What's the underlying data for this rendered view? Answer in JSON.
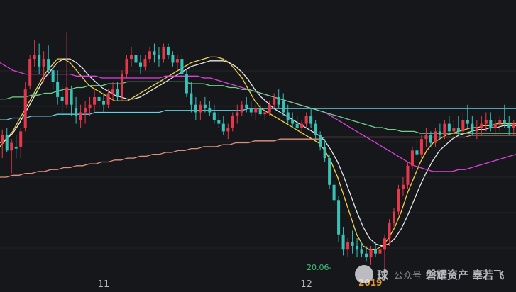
{
  "chart_data": {
    "type": "candlestick",
    "x_tick_labels": [
      {
        "label": "11",
        "bar": 22
      },
      {
        "label": "12",
        "bar": 66
      }
    ],
    "y_range": [
      0,
      100
    ],
    "date_readout": "20.06-",
    "year_badge": "2019",
    "candles": [
      {
        "o": 40,
        "h": 47,
        "l": 32,
        "c": 44
      },
      {
        "o": 44,
        "h": 48,
        "l": 35,
        "c": 36
      },
      {
        "o": 36,
        "h": 42,
        "l": 24,
        "c": 40
      },
      {
        "o": 38,
        "h": 44,
        "l": 32,
        "c": 37
      },
      {
        "o": 38,
        "h": 48,
        "l": 32,
        "c": 46
      },
      {
        "o": 48,
        "h": 72,
        "l": 46,
        "c": 68
      },
      {
        "o": 70,
        "h": 86,
        "l": 68,
        "c": 84
      },
      {
        "o": 84,
        "h": 94,
        "l": 80,
        "c": 86
      },
      {
        "o": 86,
        "h": 92,
        "l": 76,
        "c": 80
      },
      {
        "o": 80,
        "h": 88,
        "l": 72,
        "c": 84
      },
      {
        "o": 84,
        "h": 91,
        "l": 76,
        "c": 78
      },
      {
        "o": 78,
        "h": 82,
        "l": 68,
        "c": 72
      },
      {
        "o": 72,
        "h": 78,
        "l": 60,
        "c": 64
      },
      {
        "o": 64,
        "h": 70,
        "l": 54,
        "c": 62
      },
      {
        "o": 60,
        "h": 98,
        "l": 58,
        "c": 69
      },
      {
        "o": 68,
        "h": 70,
        "l": 54,
        "c": 60
      },
      {
        "o": 58,
        "h": 64,
        "l": 50,
        "c": 54
      },
      {
        "o": 52,
        "h": 60,
        "l": 48,
        "c": 56
      },
      {
        "o": 56,
        "h": 62,
        "l": 50,
        "c": 58
      },
      {
        "o": 58,
        "h": 64,
        "l": 54,
        "c": 60
      },
      {
        "o": 60,
        "h": 68,
        "l": 56,
        "c": 64
      },
      {
        "o": 64,
        "h": 70,
        "l": 58,
        "c": 62
      },
      {
        "o": 62,
        "h": 66,
        "l": 56,
        "c": 60
      },
      {
        "o": 60,
        "h": 68,
        "l": 58,
        "c": 66
      },
      {
        "o": 66,
        "h": 72,
        "l": 62,
        "c": 68
      },
      {
        "o": 68,
        "h": 72,
        "l": 62,
        "c": 64
      },
      {
        "o": 64,
        "h": 78,
        "l": 62,
        "c": 76
      },
      {
        "o": 76,
        "h": 86,
        "l": 74,
        "c": 84
      },
      {
        "o": 84,
        "h": 90,
        "l": 80,
        "c": 86
      },
      {
        "o": 86,
        "h": 88,
        "l": 78,
        "c": 82
      },
      {
        "o": 82,
        "h": 86,
        "l": 76,
        "c": 80
      },
      {
        "o": 80,
        "h": 86,
        "l": 78,
        "c": 84
      },
      {
        "o": 84,
        "h": 90,
        "l": 82,
        "c": 88
      },
      {
        "o": 88,
        "h": 92,
        "l": 82,
        "c": 86
      },
      {
        "o": 86,
        "h": 90,
        "l": 80,
        "c": 84
      },
      {
        "o": 84,
        "h": 92,
        "l": 82,
        "c": 90
      },
      {
        "o": 90,
        "h": 92,
        "l": 84,
        "c": 86
      },
      {
        "o": 86,
        "h": 88,
        "l": 80,
        "c": 82
      },
      {
        "o": 82,
        "h": 86,
        "l": 78,
        "c": 84
      },
      {
        "o": 84,
        "h": 86,
        "l": 74,
        "c": 76
      },
      {
        "o": 76,
        "h": 78,
        "l": 64,
        "c": 66
      },
      {
        "o": 66,
        "h": 72,
        "l": 56,
        "c": 60
      },
      {
        "o": 60,
        "h": 64,
        "l": 52,
        "c": 56
      },
      {
        "o": 56,
        "h": 62,
        "l": 52,
        "c": 60
      },
      {
        "o": 60,
        "h": 64,
        "l": 56,
        "c": 58
      },
      {
        "o": 58,
        "h": 62,
        "l": 54,
        "c": 56
      },
      {
        "o": 56,
        "h": 60,
        "l": 50,
        "c": 52
      },
      {
        "o": 52,
        "h": 56,
        "l": 48,
        "c": 50
      },
      {
        "o": 50,
        "h": 54,
        "l": 44,
        "c": 46
      },
      {
        "o": 46,
        "h": 50,
        "l": 42,
        "c": 48
      },
      {
        "o": 48,
        "h": 56,
        "l": 46,
        "c": 54
      },
      {
        "o": 54,
        "h": 60,
        "l": 50,
        "c": 56
      },
      {
        "o": 56,
        "h": 62,
        "l": 54,
        "c": 60
      },
      {
        "o": 60,
        "h": 64,
        "l": 56,
        "c": 58
      },
      {
        "o": 58,
        "h": 62,
        "l": 54,
        "c": 56
      },
      {
        "o": 56,
        "h": 60,
        "l": 52,
        "c": 58
      },
      {
        "o": 58,
        "h": 60,
        "l": 54,
        "c": 55
      },
      {
        "o": 55,
        "h": 58,
        "l": 52,
        "c": 56
      },
      {
        "o": 56,
        "h": 62,
        "l": 54,
        "c": 60
      },
      {
        "o": 60,
        "h": 66,
        "l": 58,
        "c": 64
      },
      {
        "o": 64,
        "h": 68,
        "l": 58,
        "c": 60
      },
      {
        "o": 62,
        "h": 66,
        "l": 54,
        "c": 56
      },
      {
        "o": 56,
        "h": 60,
        "l": 50,
        "c": 52
      },
      {
        "o": 52,
        "h": 56,
        "l": 48,
        "c": 50
      },
      {
        "o": 50,
        "h": 54,
        "l": 46,
        "c": 48
      },
      {
        "o": 48,
        "h": 52,
        "l": 44,
        "c": 50
      },
      {
        "o": 50,
        "h": 56,
        "l": 48,
        "c": 54
      },
      {
        "o": 54,
        "h": 58,
        "l": 48,
        "c": 50
      },
      {
        "o": 50,
        "h": 52,
        "l": 42,
        "c": 44
      },
      {
        "o": 44,
        "h": 46,
        "l": 36,
        "c": 38
      },
      {
        "o": 38,
        "h": 42,
        "l": 30,
        "c": 32
      },
      {
        "o": 32,
        "h": 34,
        "l": 16,
        "c": 18
      },
      {
        "o": 18,
        "h": 20,
        "l": 8,
        "c": 10
      },
      {
        "o": 10,
        "h": 12,
        "l": -12,
        "c": -8
      },
      {
        "o": -8,
        "h": -4,
        "l": -19,
        "c": -16
      },
      {
        "o": -16,
        "h": -10,
        "l": -20,
        "c": -12
      },
      {
        "o": -12,
        "h": -6,
        "l": -18,
        "c": -14
      },
      {
        "o": -14,
        "h": -10,
        "l": -20,
        "c": -16
      },
      {
        "o": -16,
        "h": -12,
        "l": -20,
        "c": -18
      },
      {
        "o": -18,
        "h": -14,
        "l": -22,
        "c": -20
      },
      {
        "o": -20,
        "h": -14,
        "l": -24,
        "c": -16
      },
      {
        "o": -16,
        "h": -12,
        "l": -20,
        "c": -18
      },
      {
        "o": -18,
        "h": -12,
        "l": -22,
        "c": -16
      },
      {
        "o": -16,
        "h": -8,
        "l": -26,
        "c": -10
      },
      {
        "o": -10,
        "h": 0,
        "l": -14,
        "c": -2
      },
      {
        "o": -2,
        "h": 6,
        "l": -4,
        "c": 4
      },
      {
        "o": 4,
        "h": 18,
        "l": 2,
        "c": 16
      },
      {
        "o": 16,
        "h": 22,
        "l": 12,
        "c": 18
      },
      {
        "o": 18,
        "h": 30,
        "l": 16,
        "c": 28
      },
      {
        "o": 28,
        "h": 38,
        "l": 26,
        "c": 36
      },
      {
        "o": 36,
        "h": 42,
        "l": 32,
        "c": 34
      },
      {
        "o": 34,
        "h": 44,
        "l": 32,
        "c": 42
      },
      {
        "o": 42,
        "h": 48,
        "l": 38,
        "c": 44
      },
      {
        "o": 44,
        "h": 46,
        "l": 38,
        "c": 40
      },
      {
        "o": 40,
        "h": 48,
        "l": 38,
        "c": 46
      },
      {
        "o": 46,
        "h": 50,
        "l": 42,
        "c": 44
      },
      {
        "o": 44,
        "h": 52,
        "l": 42,
        "c": 50
      },
      {
        "o": 50,
        "h": 54,
        "l": 44,
        "c": 46
      },
      {
        "o": 46,
        "h": 52,
        "l": 42,
        "c": 48
      },
      {
        "o": 48,
        "h": 54,
        "l": 44,
        "c": 46
      },
      {
        "o": 46,
        "h": 56,
        "l": 44,
        "c": 52
      },
      {
        "o": 52,
        "h": 60,
        "l": 48,
        "c": 50
      },
      {
        "o": 50,
        "h": 54,
        "l": 44,
        "c": 46
      },
      {
        "o": 46,
        "h": 52,
        "l": 42,
        "c": 48
      },
      {
        "o": 48,
        "h": 54,
        "l": 44,
        "c": 50
      },
      {
        "o": 50,
        "h": 56,
        "l": 46,
        "c": 52
      },
      {
        "o": 52,
        "h": 56,
        "l": 46,
        "c": 48
      },
      {
        "o": 48,
        "h": 52,
        "l": 44,
        "c": 50
      },
      {
        "o": 50,
        "h": 54,
        "l": 46,
        "c": 52
      },
      {
        "o": 52,
        "h": 60,
        "l": 48,
        "c": 50
      },
      {
        "o": 50,
        "h": 54,
        "l": 44,
        "c": 48
      },
      {
        "o": 48,
        "h": 52,
        "l": 44,
        "c": 50
      }
    ],
    "lines": [
      {
        "color": "#f2d24a",
        "values": [
          38,
          42,
          46,
          52,
          58,
          64,
          70,
          76,
          80,
          84,
          84,
          82,
          78,
          74,
          70,
          68,
          66,
          64,
          62,
          62,
          62,
          64,
          66,
          68,
          70,
          72,
          74,
          76,
          78,
          80,
          82,
          83,
          84,
          85,
          85,
          84,
          82,
          78,
          74,
          68,
          62,
          58,
          56,
          54,
          52,
          50,
          48,
          46,
          44,
          42,
          40,
          36,
          30,
          22,
          12,
          2,
          -8,
          -14,
          -16,
          -16,
          -14,
          -10,
          -4,
          4,
          14,
          22,
          30,
          36,
          40,
          42,
          44,
          45,
          46,
          47,
          48,
          48,
          49,
          49,
          50,
          50,
          50,
          50
        ]
      },
      {
        "color": "#e8e8e8",
        "values": [
          40,
          42,
          45,
          50,
          56,
          62,
          68,
          74,
          78,
          82,
          84,
          84,
          82,
          79,
          75,
          72,
          69,
          67,
          65,
          64,
          63,
          63,
          64,
          66,
          68,
          70,
          72,
          74,
          76,
          78,
          80,
          81,
          82,
          83,
          83,
          83,
          82,
          80,
          77,
          73,
          68,
          64,
          61,
          58,
          56,
          54,
          52,
          50,
          48,
          46,
          44,
          41,
          36,
          30,
          22,
          13,
          4,
          -4,
          -10,
          -13,
          -14,
          -13,
          -10,
          -5,
          2,
          10,
          18,
          25,
          31,
          36,
          39,
          42,
          44,
          45,
          46,
          47,
          47,
          48,
          48,
          49,
          49,
          49
        ]
      },
      {
        "color": "#e040e0",
        "values": [
          82,
          80,
          78,
          77,
          76,
          76,
          76,
          76,
          76,
          76,
          76,
          76,
          75,
          75,
          75,
          75,
          74,
          74,
          74,
          74,
          74,
          74,
          74,
          74,
          74,
          74,
          75,
          75,
          75,
          75,
          75,
          75,
          74,
          74,
          73,
          72,
          71,
          70,
          69,
          68,
          67,
          66,
          65,
          64,
          63,
          62,
          61,
          60,
          59,
          58,
          57,
          56,
          54,
          52,
          50,
          48,
          46,
          44,
          42,
          40,
          38,
          36,
          34,
          32,
          30,
          28,
          27,
          26,
          25,
          25,
          25,
          25,
          26,
          26,
          27,
          28,
          29,
          30,
          31,
          32,
          33,
          34
        ]
      },
      {
        "color": "#6fd08a",
        "values": [
          63,
          63,
          64,
          64,
          64,
          65,
          65,
          66,
          66,
          67,
          68,
          68,
          69,
          69,
          70,
          70,
          70,
          71,
          71,
          71,
          72,
          72,
          72,
          72,
          72,
          72,
          72,
          72,
          72,
          72,
          71,
          71,
          71,
          70,
          70,
          70,
          69,
          69,
          68,
          68,
          67,
          66,
          65,
          64,
          63,
          62,
          61,
          60,
          59,
          58,
          57,
          56,
          55,
          54,
          53,
          52,
          51,
          50,
          49,
          48,
          48,
          47,
          47,
          46,
          46,
          46,
          45,
          45,
          45,
          45,
          45,
          45,
          45,
          45,
          45,
          45,
          45,
          45,
          45,
          45,
          45,
          45
        ]
      },
      {
        "color": "#5fd4e6",
        "values": [
          52,
          52,
          53,
          53,
          53,
          54,
          54,
          54,
          54,
          55,
          55,
          55,
          55,
          55,
          55,
          56,
          56,
          56,
          56,
          56,
          56,
          56,
          56,
          56,
          56,
          56,
          57,
          57,
          57,
          57,
          57,
          57,
          57,
          57,
          57,
          57,
          57,
          57,
          57,
          58,
          58,
          58,
          58,
          58,
          58,
          58,
          58,
          58,
          58,
          58,
          58,
          58,
          58,
          58,
          58,
          58,
          58,
          58,
          58,
          58,
          58,
          58,
          58,
          58,
          58,
          58,
          58,
          58,
          58,
          58,
          58,
          58,
          58,
          58,
          58,
          58,
          58,
          58,
          58,
          58,
          58,
          58
        ]
      },
      {
        "color": "#e0907e",
        "values": [
          22,
          22,
          23,
          23,
          24,
          24,
          25,
          25,
          26,
          26,
          27,
          27,
          28,
          28,
          29,
          29,
          30,
          30,
          31,
          31,
          32,
          32,
          33,
          33,
          34,
          34,
          35,
          35,
          36,
          36,
          37,
          37,
          38,
          38,
          38,
          39,
          39,
          40,
          40,
          40,
          41,
          41,
          41,
          41,
          42,
          42,
          42,
          42,
          42,
          42,
          42,
          43,
          43,
          43,
          43,
          43,
          43,
          43,
          43,
          43,
          43,
          43,
          43,
          43,
          43,
          43,
          43,
          43,
          43,
          43,
          43,
          43,
          43,
          43,
          44,
          44,
          44,
          44,
          44,
          44,
          44,
          44
        ]
      }
    ]
  },
  "watermark": {
    "logo": "雪",
    "brand": "球",
    "channel": "公众号",
    "text": "磐耀资产 辜若飞"
  },
  "colors": {
    "background": "#16171b",
    "up_candle": "#e5384a",
    "down_candle": "#39c1b8",
    "grid": "#232429"
  }
}
